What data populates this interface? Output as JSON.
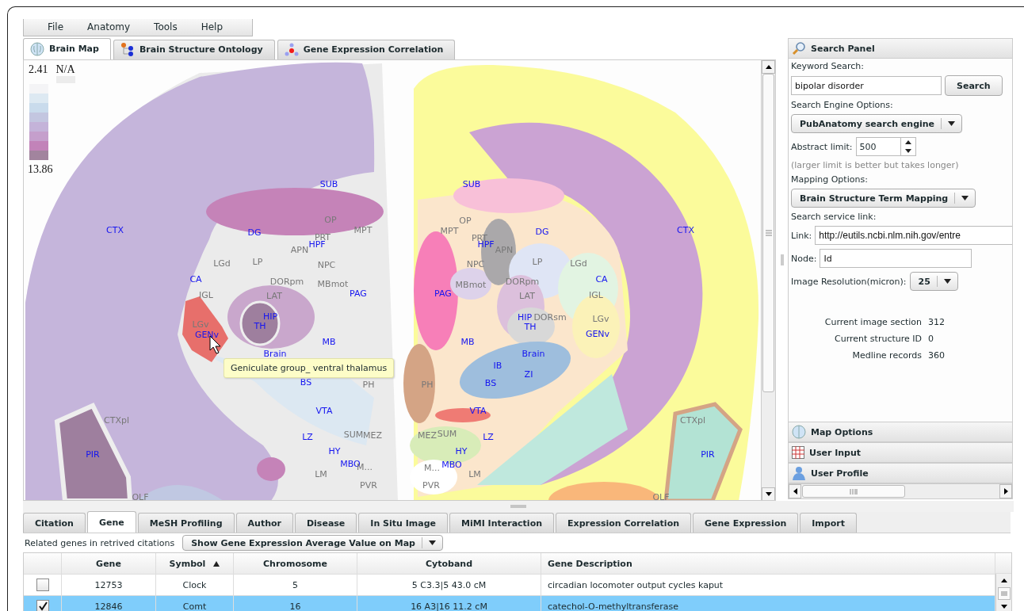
{
  "menu": [
    {
      "label": "File"
    },
    {
      "label": "Anatomy"
    },
    {
      "label": "Tools"
    },
    {
      "label": "Help"
    }
  ],
  "view_tabs": [
    {
      "label": "Brain Map",
      "selected": true
    },
    {
      "label": "Brain Structure Ontology",
      "selected": false
    },
    {
      "label": "Gene Expression Correlation",
      "selected": false
    }
  ],
  "legend": {
    "top_value": "2.41",
    "na_label": "N/A",
    "bottom_value": "13.86"
  },
  "brain_map": {
    "left_hemisphere_labels": [
      {
        "text": "SUB",
        "kind": "major"
      },
      {
        "text": "OP",
        "kind": "minor"
      },
      {
        "text": "CTX",
        "kind": "major"
      },
      {
        "text": "DG",
        "kind": "major"
      },
      {
        "text": "MPT",
        "kind": "minor"
      },
      {
        "text": "PRT",
        "kind": "minor"
      },
      {
        "text": "HPF",
        "kind": "major"
      },
      {
        "text": "APN",
        "kind": "minor"
      },
      {
        "text": "LGd",
        "kind": "minor"
      },
      {
        "text": "LP",
        "kind": "minor"
      },
      {
        "text": "NPC",
        "kind": "minor"
      },
      {
        "text": "CA",
        "kind": "major"
      },
      {
        "text": "DORpm",
        "kind": "minor"
      },
      {
        "text": "MBmot",
        "kind": "minor"
      },
      {
        "text": "IGL",
        "kind": "minor"
      },
      {
        "text": "LAT",
        "kind": "minor"
      },
      {
        "text": "PAG",
        "kind": "major"
      },
      {
        "text": "HIP",
        "kind": "major"
      },
      {
        "text": "LGv",
        "kind": "minor"
      },
      {
        "text": "TH",
        "kind": "major"
      },
      {
        "text": "GENv",
        "kind": "major"
      },
      {
        "text": "MB",
        "kind": "major"
      },
      {
        "text": "Brain",
        "kind": "major"
      },
      {
        "text": "BS",
        "kind": "major"
      },
      {
        "text": "PH",
        "kind": "minor"
      },
      {
        "text": "VTA",
        "kind": "major"
      },
      {
        "text": "CTXpl",
        "kind": "minor"
      },
      {
        "text": "LZ",
        "kind": "major"
      },
      {
        "text": "SUM",
        "kind": "minor"
      },
      {
        "text": "MEZ",
        "kind": "minor"
      },
      {
        "text": "PIR",
        "kind": "major"
      },
      {
        "text": "HY",
        "kind": "major"
      },
      {
        "text": "MBO",
        "kind": "major"
      },
      {
        "text": "M...",
        "kind": "minor"
      },
      {
        "text": "LM",
        "kind": "minor"
      },
      {
        "text": "PVR",
        "kind": "minor"
      },
      {
        "text": "OLF",
        "kind": "minor"
      }
    ],
    "right_hemisphere_labels": [
      {
        "text": "SUB",
        "kind": "major"
      },
      {
        "text": "OP",
        "kind": "minor"
      },
      {
        "text": "MPT",
        "kind": "minor"
      },
      {
        "text": "DG",
        "kind": "major"
      },
      {
        "text": "CTX",
        "kind": "major"
      },
      {
        "text": "PRT",
        "kind": "minor"
      },
      {
        "text": "HPF",
        "kind": "major"
      },
      {
        "text": "APN",
        "kind": "minor"
      },
      {
        "text": "NPC",
        "kind": "minor"
      },
      {
        "text": "LP",
        "kind": "minor"
      },
      {
        "text": "LGd",
        "kind": "minor"
      },
      {
        "text": "MBmot",
        "kind": "minor"
      },
      {
        "text": "DORpm",
        "kind": "minor"
      },
      {
        "text": "CA",
        "kind": "major"
      },
      {
        "text": "PAG",
        "kind": "major"
      },
      {
        "text": "LAT",
        "kind": "minor"
      },
      {
        "text": "IGL",
        "kind": "minor"
      },
      {
        "text": "HIP",
        "kind": "major"
      },
      {
        "text": "DORsm",
        "kind": "minor"
      },
      {
        "text": "LGv",
        "kind": "minor"
      },
      {
        "text": "TH",
        "kind": "major"
      },
      {
        "text": "GENv",
        "kind": "major"
      },
      {
        "text": "MB",
        "kind": "major"
      },
      {
        "text": "Brain",
        "kind": "major"
      },
      {
        "text": "IB",
        "kind": "major"
      },
      {
        "text": "ZI",
        "kind": "major"
      },
      {
        "text": "PH",
        "kind": "minor"
      },
      {
        "text": "BS",
        "kind": "major"
      },
      {
        "text": "VTA",
        "kind": "major"
      },
      {
        "text": "CTXpl",
        "kind": "minor"
      },
      {
        "text": "MEZ",
        "kind": "minor"
      },
      {
        "text": "SUM",
        "kind": "minor"
      },
      {
        "text": "LZ",
        "kind": "major"
      },
      {
        "text": "HY",
        "kind": "major"
      },
      {
        "text": "PIR",
        "kind": "major"
      },
      {
        "text": "M...",
        "kind": "minor"
      },
      {
        "text": "MBO",
        "kind": "major"
      },
      {
        "text": "LM",
        "kind": "minor"
      },
      {
        "text": "PVR",
        "kind": "minor"
      },
      {
        "text": "OLF",
        "kind": "minor"
      }
    ],
    "tooltip": "Geniculate group_ ventral thalamus"
  },
  "search_panel": {
    "title": "Search Panel",
    "keyword_label": "Keyword Search:",
    "keyword": "bipolar disorder",
    "search_button": "Search",
    "engine_label": "Search Engine Options:",
    "engine": "PubAnatomy search engine",
    "abstract_label": "Abstract limit:",
    "abstract_limit": "500",
    "abstract_hint": "(larger limit is better but takes longer)",
    "mapping_label": "Mapping Options:",
    "mapping": "Brain Structure Term Mapping",
    "service_label": "Search service link:",
    "link_label": "Link:",
    "link": "http://eutils.ncbi.nlm.nih.gov/entre",
    "node_label": "Node:",
    "node": "Id",
    "resolution_label": "Image Resolution(micron):",
    "resolution": "25",
    "stats": [
      {
        "label": "Current image section",
        "value": "312"
      },
      {
        "label": "Current structure ID",
        "value": "0"
      },
      {
        "label": "Medline records",
        "value": "360"
      }
    ]
  },
  "accordion": [
    {
      "title": "Map Options"
    },
    {
      "title": "User Input"
    },
    {
      "title": "User Profile"
    }
  ],
  "result_tabs": [
    {
      "label": "Citation",
      "selected": false
    },
    {
      "label": "Gene",
      "selected": true
    },
    {
      "label": "MeSH Profiling",
      "selected": false
    },
    {
      "label": "Author",
      "selected": false
    },
    {
      "label": "Disease",
      "selected": false
    },
    {
      "label": "In Situ Image",
      "selected": false
    },
    {
      "label": "MiMI Interaction",
      "selected": false
    },
    {
      "label": "Expression Correlation",
      "selected": false
    },
    {
      "label": "Gene Expression",
      "selected": false
    },
    {
      "label": "Import",
      "selected": false
    }
  ],
  "gene_toolbar": {
    "caption": "Related genes in retrived citations",
    "map_option": "Show Gene Expression Average Value on Map"
  },
  "gene_table": {
    "columns": [
      {
        "label": "Gene",
        "sorted": false
      },
      {
        "label": "Symbol",
        "sorted": true
      },
      {
        "label": "Chromosome",
        "sorted": false
      },
      {
        "label": "Cytoband",
        "sorted": false
      },
      {
        "label": "Gene Description",
        "sorted": false
      }
    ],
    "rows": [
      {
        "checked": false,
        "selected": false,
        "cells": [
          "12753",
          "Clock",
          "5",
          "5 C3.3|5 43.0 cM",
          "circadian locomoter output cycles kaput"
        ]
      },
      {
        "checked": true,
        "selected": true,
        "cells": [
          "12846",
          "Comt",
          "16",
          "16 A3|16 11.2 cM",
          "catechol-O-methyltransferase"
        ]
      }
    ]
  }
}
